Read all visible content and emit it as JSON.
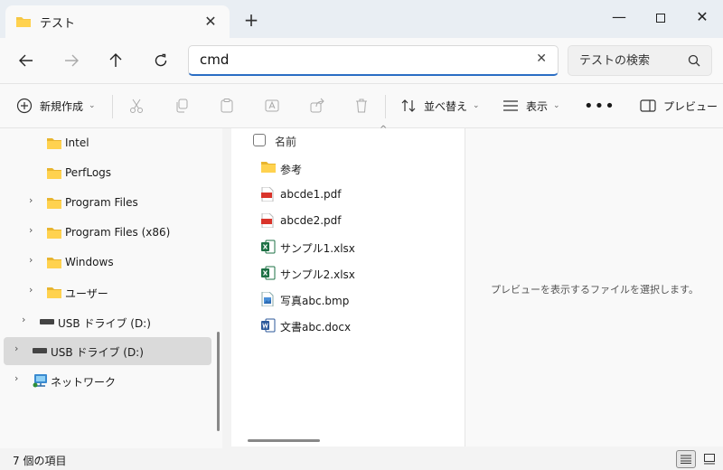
{
  "window": {
    "tab_title": "テスト",
    "tab_close_glyph": "✕",
    "new_tab_glyph": "+",
    "minimize_glyph": "—",
    "close_glyph": "✕"
  },
  "address": {
    "value": "cmd",
    "clear_glyph": "✕"
  },
  "search": {
    "placeholder": "テストの検索"
  },
  "commands": {
    "new_label": "新規作成",
    "sort_label": "並べ替え",
    "view_label": "表示",
    "more_glyph": "•••",
    "preview_label": "プレビュー",
    "chevron_glyph": "⌄"
  },
  "nav": {
    "expander_glyph": "›",
    "items": [
      {
        "label": "Intel"
      },
      {
        "label": "PerfLogs"
      },
      {
        "label": "Program Files"
      },
      {
        "label": "Program Files (x86)"
      },
      {
        "label": "Windows"
      },
      {
        "label": "ユーザー"
      },
      {
        "label": "USB ドライブ (D:)"
      },
      {
        "label": "USB ドライブ (D:)"
      },
      {
        "label": "ネットワーク"
      }
    ]
  },
  "files": {
    "column_name": "名前",
    "sort_caret": "^",
    "items": [
      {
        "name": "参考",
        "type": "folder"
      },
      {
        "name": "abcde1.pdf",
        "type": "pdf"
      },
      {
        "name": "abcde2.pdf",
        "type": "pdf"
      },
      {
        "name": "サンプル1.xlsx",
        "type": "excel"
      },
      {
        "name": "サンプル2.xlsx",
        "type": "excel"
      },
      {
        "name": "写真abc.bmp",
        "type": "image"
      },
      {
        "name": "文書abc.docx",
        "type": "word"
      }
    ]
  },
  "preview": {
    "message": "プレビューを表示するファイルを選択します。"
  },
  "status": {
    "item_count": "7 個の項目"
  },
  "colors": {
    "accent": "#2a6dc4",
    "folder": "#f6c744",
    "pdf": "#d9342b",
    "excel": "#1e7145",
    "word": "#2b579a"
  }
}
